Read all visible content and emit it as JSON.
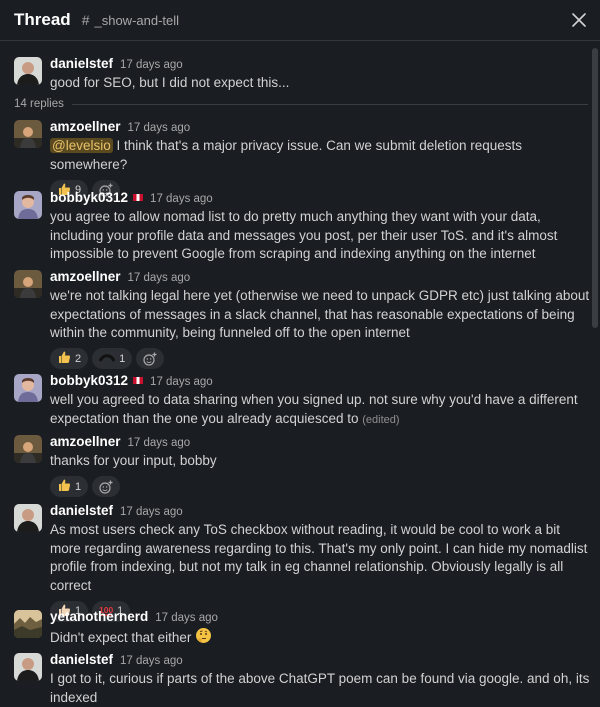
{
  "header": {
    "title": "Thread",
    "hash": "#",
    "channel": "_show-and-tell",
    "close_icon": "close-icon"
  },
  "parent": {
    "author": "danielstef",
    "time": "17 days ago",
    "text": "good for SEO, but I did not expect this..."
  },
  "replies_count": "14 replies",
  "messages": [
    {
      "author": "amzoellner",
      "time": "17 days ago",
      "mention": "@levelsio",
      "text": "I think that's a major privacy issue. Can we submit deletion requests somewhere?",
      "reactions": [
        {
          "icon": "thumbs-up",
          "count": "9"
        }
      ]
    },
    {
      "author": "bobbyk0312",
      "flag": "peru-flag",
      "time": "17 days ago",
      "text": "you agree to allow nomad list to do pretty much anything they want with your data, including your profile data and messages you post, per their user ToS. and it's almost impossible to prevent Google from scraping and indexing anything on the internet"
    },
    {
      "author": "amzoellner",
      "time": "17 days ago",
      "text": "we're not talking legal here yet (otherwise we need to unpack GDPR etc) just talking about expectations of messages in a slack channel, that has reasonable expectations of being within the community, being funneled off to the open internet",
      "reactions": [
        {
          "icon": "thumbs-up",
          "count": "2"
        },
        {
          "icon": "arch",
          "count": "1"
        }
      ]
    },
    {
      "author": "bobbyk0312",
      "flag": "peru-flag",
      "time": "17 days ago",
      "text": "well you agreed to data sharing when you signed up. not sure why you'd have a different expectation than the one you already acquiesced  to",
      "edited": "(edited)"
    },
    {
      "author": "amzoellner",
      "time": "17 days ago",
      "text": "thanks for your input, bobby",
      "reactions": [
        {
          "icon": "thumbs-up",
          "count": "1"
        }
      ]
    },
    {
      "author": "danielstef",
      "time": "17 days ago",
      "text": "As most users check any ToS checkbox without reading, it would be cool to work a bit more regarding awareness regarding to this. That's my only point. I can hide my nomadlist profile from indexing, but not my talk in eg channel relationship. Obviously legally is all correct",
      "reactions": [
        {
          "icon": "thumbs-up-light",
          "count": "1"
        },
        {
          "icon": "hundred",
          "count": "1"
        }
      ]
    },
    {
      "author": "yetanothernerd",
      "time": "17 days ago",
      "text": "Didn't expect that either",
      "emoji": "thinking-face"
    },
    {
      "author": "danielstef",
      "time": "17 days ago",
      "text": "I got to it, curious if parts of the above ChatGPT poem can be found via google. and oh, its indexed"
    }
  ],
  "add_reaction_icon": "add-reaction-icon",
  "colors": {
    "background": "#1a1d21",
    "text": "#d1d2d3",
    "muted": "#a7a8aa",
    "mention_bg": "#5b4a1f",
    "mention_text": "#e8c26a",
    "reaction_bg": "#2b2e33"
  }
}
